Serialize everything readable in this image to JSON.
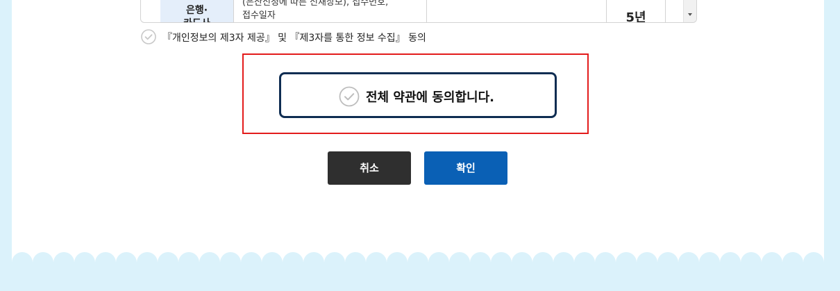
{
  "table": {
    "row_header_line1": "은행·",
    "row_header_line2": "카드사",
    "items_line1": "(은산신청에 따른 신재상보), 접수번호,",
    "items_line2": "접수일자",
    "retention_period": "5년"
  },
  "consent": {
    "third_party_label": "『개인정보의 제3자 제공』 및 『제3자를 통한 정보 수집』 동의",
    "agree_all_label": "전체 약관에 동의합니다."
  },
  "buttons": {
    "cancel_label": "취소",
    "confirm_label": "확인"
  },
  "icons": {
    "check": "check-circle-icon",
    "scroll_down": "chevron-down-icon"
  },
  "colors": {
    "page_background": "#dbf2fb",
    "agree_border": "#0f2d52",
    "highlight_border": "#e31b1b",
    "cancel_button": "#2f2f2f",
    "confirm_button": "#0a60b5",
    "table_header_bg": "#e4eefa"
  }
}
